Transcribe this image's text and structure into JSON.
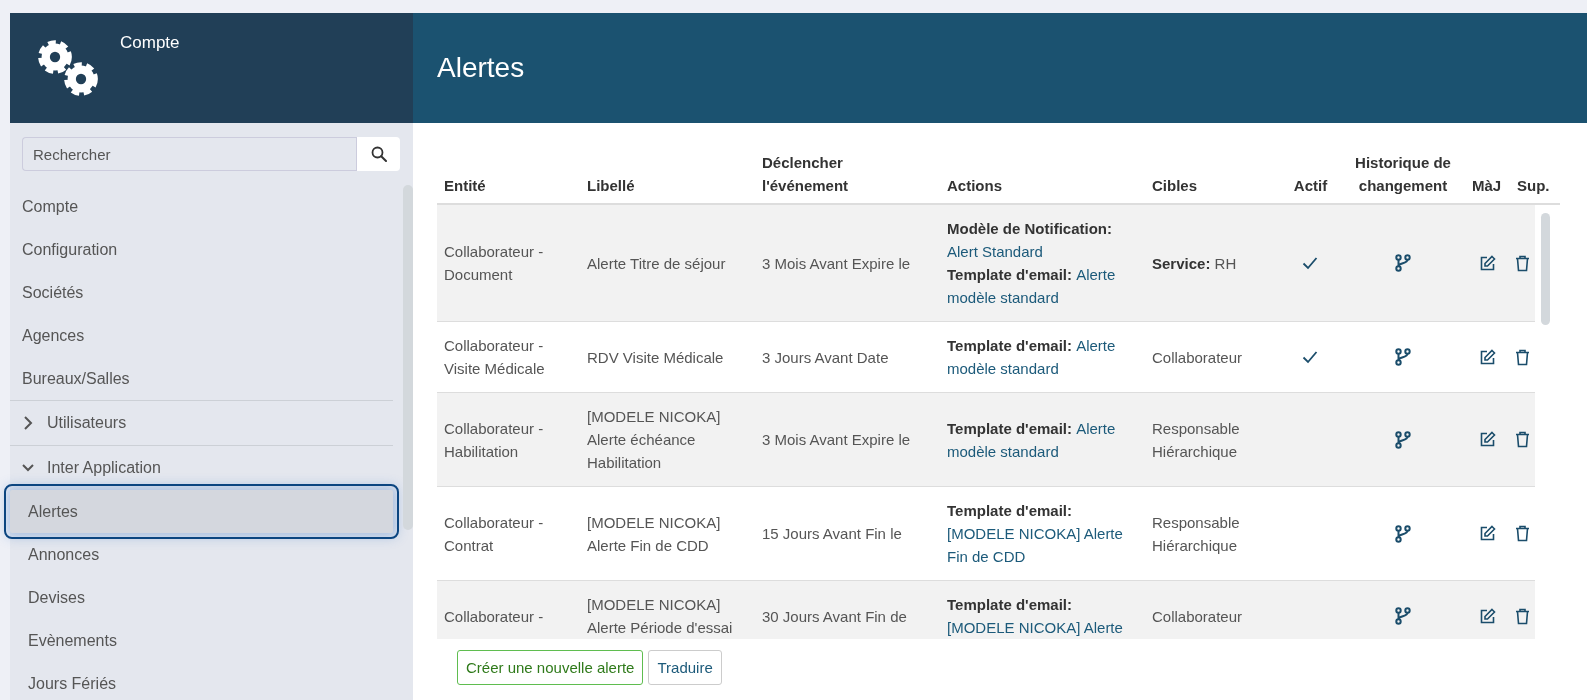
{
  "sidebar": {
    "title": "Compte",
    "search": {
      "placeholder": "Rechercher"
    },
    "items": [
      {
        "kind": "link",
        "label": "Compte",
        "selected": false
      },
      {
        "kind": "link",
        "label": "Configuration",
        "selected": false
      },
      {
        "kind": "link",
        "label": "Sociétés",
        "selected": false
      },
      {
        "kind": "link",
        "label": "Agences",
        "selected": false
      },
      {
        "kind": "link",
        "label": "Bureaux/Salles",
        "selected": false
      },
      {
        "kind": "group",
        "label": "Utilisateurs",
        "expanded": false
      },
      {
        "kind": "group",
        "label": "Inter Application",
        "expanded": true,
        "children": [
          {
            "label": "Alertes",
            "selected": true
          },
          {
            "label": "Annonces",
            "selected": false
          },
          {
            "label": "Devises",
            "selected": false
          },
          {
            "label": "Evènements",
            "selected": false
          },
          {
            "label": "Jours Fériés",
            "selected": false
          }
        ]
      }
    ]
  },
  "main": {
    "title": "Alertes",
    "table": {
      "columns": [
        "Entité",
        "Libellé",
        "Déclencher l'événement",
        "Actions",
        "Cibles",
        "Actif",
        "Historique de changement",
        "MàJ",
        "Sup."
      ],
      "rows": [
        {
          "entity": "Collaborateur - Document",
          "label": "Alerte Titre de séjour",
          "trigger": "3 Mois Avant Expire le",
          "actions": [
            {
              "label": "Modèle de Notification:",
              "value": "Alert Standard"
            },
            {
              "label": "Template d'email:",
              "value": "Alerte modèle standard"
            }
          ],
          "targets": "**Service:** RH",
          "active": true
        },
        {
          "entity": "Collaborateur - Visite Médicale",
          "label": "RDV Visite Médicale",
          "trigger": "3 Jours Avant Date",
          "actions": [
            {
              "label": "Template d'email:",
              "value": "Alerte modèle standard"
            }
          ],
          "targets": "Collaborateur",
          "active": true
        },
        {
          "entity": "Collaborateur - Habilitation",
          "label": "[MODELE NICOKA] Alerte échéance Habilitation",
          "trigger": "3 Mois Avant Expire le",
          "actions": [
            {
              "label": "Template d'email:",
              "value": "Alerte modèle standard"
            }
          ],
          "targets": "Responsable Hiérarchique",
          "active": false
        },
        {
          "entity": "Collaborateur - Contrat",
          "label": "[MODELE NICOKA] Alerte Fin de CDD",
          "trigger": "15 Jours Avant Fin le",
          "actions": [
            {
              "label": "Template d'email:",
              "value": "[MODELE NICOKA] Alerte Fin de CDD"
            }
          ],
          "targets": "Responsable Hiérarchique",
          "active": false
        },
        {
          "entity": "Collaborateur -",
          "label": "[MODELE NICOKA] Alerte Période d'essai",
          "trigger": "30 Jours Avant Fin de",
          "actions": [
            {
              "label": "Template d'email:",
              "value": "[MODELE NICOKA] Alerte"
            }
          ],
          "targets": "Collaborateur",
          "active": false
        }
      ]
    },
    "buttons": [
      {
        "kind": "success",
        "label": "Créer une nouvelle alerte"
      },
      {
        "kind": "default",
        "label": "Traduire"
      }
    ]
  }
}
